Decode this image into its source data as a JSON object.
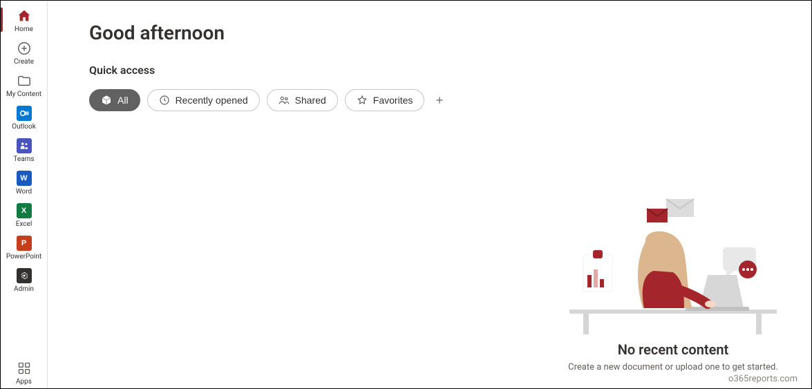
{
  "sidebar": {
    "items": [
      {
        "label": "Home"
      },
      {
        "label": "Create"
      },
      {
        "label": "My Content"
      },
      {
        "label": "Outlook"
      },
      {
        "label": "Teams"
      },
      {
        "label": "Word"
      },
      {
        "label": "Excel"
      },
      {
        "label": "PowerPoint"
      },
      {
        "label": "Admin"
      }
    ],
    "apps_label": "Apps"
  },
  "main": {
    "greeting": "Good afternoon",
    "quick_access_title": "Quick access",
    "pills": {
      "all": "All",
      "recently_opened": "Recently opened",
      "shared": "Shared",
      "favorites": "Favorites"
    }
  },
  "empty": {
    "title": "No recent content",
    "subtitle": "Create a new document or upload one to get started."
  },
  "watermark": "o365reports.com",
  "colors": {
    "brand_accent": "#a4262c",
    "outlook": "#0078d4",
    "teams": "#4b53bc",
    "word": "#185abd",
    "excel": "#107c41",
    "powerpoint": "#c43e1c",
    "admin": "#323130"
  }
}
